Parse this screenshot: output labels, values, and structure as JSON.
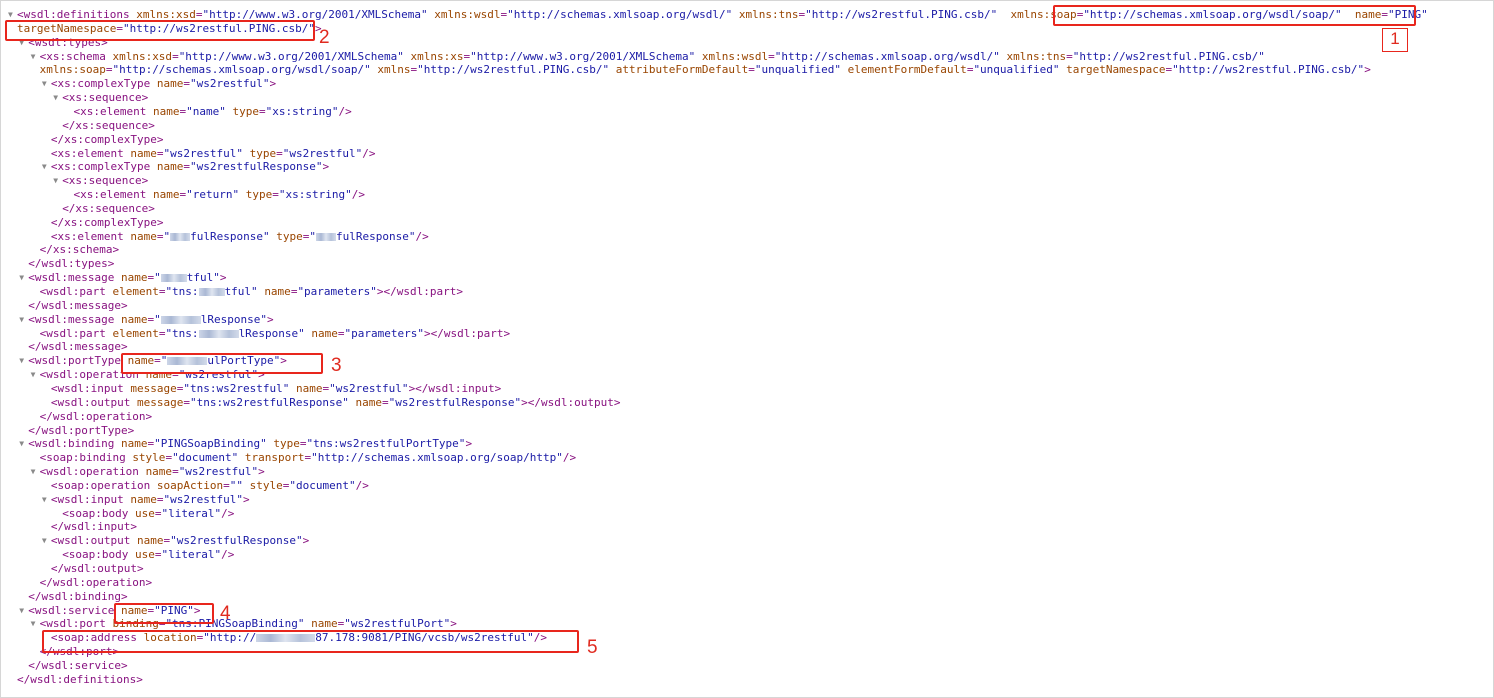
{
  "lines": [
    {
      "i": 0,
      "t": 1,
      "p": [
        [
          "t",
          "<wsdl:definitions "
        ],
        [
          "n",
          "xmlns:xsd"
        ],
        [
          "t",
          "="
        ],
        [
          "v",
          "\"http://www.w3.org/2001/XMLSchema\""
        ],
        [
          "t",
          " "
        ],
        [
          "n",
          "xmlns:wsdl"
        ],
        [
          "t",
          "="
        ],
        [
          "v",
          "\"http://schemas.xmlsoap.org/wsdl/\""
        ],
        [
          "t",
          " "
        ],
        [
          "n",
          "xmlns:tns"
        ],
        [
          "t",
          "="
        ],
        [
          "v",
          "\"http://ws2restful.PING.csb/\""
        ],
        [
          "t",
          "  "
        ],
        [
          "n",
          "xmlns:soap"
        ],
        [
          "t",
          "="
        ],
        [
          "v",
          "\"http://schemas.xmlsoap.org/wsdl/soap/\""
        ],
        [
          "t",
          "  "
        ],
        [
          "n",
          "name"
        ],
        [
          "t",
          "="
        ],
        [
          "v",
          "\"PING\""
        ]
      ]
    },
    {
      "i": 0,
      "t": 0,
      "p": [
        [
          "n",
          "targetNamespace"
        ],
        [
          "t",
          "="
        ],
        [
          "v",
          "\"http://ws2restful.PING.csb/\""
        ],
        [
          "t",
          ">"
        ]
      ]
    },
    {
      "i": 1,
      "t": 1,
      "p": [
        [
          "t",
          "<wsdl:types>"
        ]
      ]
    },
    {
      "i": 2,
      "t": 1,
      "p": [
        [
          "t",
          "<xs:schema "
        ],
        [
          "n",
          "xmlns:xsd"
        ],
        [
          "t",
          "="
        ],
        [
          "v",
          "\"http://www.w3.org/2001/XMLSchema\""
        ],
        [
          "t",
          " "
        ],
        [
          "n",
          "xmlns:xs"
        ],
        [
          "t",
          "="
        ],
        [
          "v",
          "\"http://www.w3.org/2001/XMLSchema\""
        ],
        [
          "t",
          " "
        ],
        [
          "n",
          "xmlns:wsdl"
        ],
        [
          "t",
          "="
        ],
        [
          "v",
          "\"http://schemas.xmlsoap.org/wsdl/\""
        ],
        [
          "t",
          " "
        ],
        [
          "n",
          "xmlns:tns"
        ],
        [
          "t",
          "="
        ],
        [
          "v",
          "\"http://ws2restful.PING.csb/\""
        ]
      ]
    },
    {
      "i": 2,
      "t": 0,
      "p": [
        [
          "n",
          "xmlns:soap"
        ],
        [
          "t",
          "="
        ],
        [
          "v",
          "\"http://schemas.xmlsoap.org/wsdl/soap/\""
        ],
        [
          "t",
          " "
        ],
        [
          "n",
          "xmlns"
        ],
        [
          "t",
          "="
        ],
        [
          "v",
          "\"http://ws2restful.PING.csb/\""
        ],
        [
          "t",
          " "
        ],
        [
          "n",
          "attributeFormDefault"
        ],
        [
          "t",
          "="
        ],
        [
          "v",
          "\"unqualified\""
        ],
        [
          "t",
          " "
        ],
        [
          "n",
          "elementFormDefault"
        ],
        [
          "t",
          "="
        ],
        [
          "v",
          "\"unqualified\""
        ],
        [
          "t",
          " "
        ],
        [
          "n",
          "targetNamespace"
        ],
        [
          "t",
          "="
        ],
        [
          "v",
          "\"http://ws2restful.PING.csb/\""
        ],
        [
          "t",
          ">"
        ]
      ]
    },
    {
      "i": 3,
      "t": 1,
      "p": [
        [
          "t",
          "<xs:complexType "
        ],
        [
          "n",
          "name"
        ],
        [
          "t",
          "="
        ],
        [
          "v",
          "\"ws2restful\""
        ],
        [
          "t",
          ">"
        ]
      ]
    },
    {
      "i": 4,
      "t": 1,
      "p": [
        [
          "t",
          "<xs:sequence>"
        ]
      ]
    },
    {
      "i": 5,
      "t": 0,
      "p": [
        [
          "t",
          "<xs:element "
        ],
        [
          "n",
          "name"
        ],
        [
          "t",
          "="
        ],
        [
          "v",
          "\"name\""
        ],
        [
          "t",
          " "
        ],
        [
          "n",
          "type"
        ],
        [
          "t",
          "="
        ],
        [
          "v",
          "\"xs:string\""
        ],
        [
          "t",
          "/>"
        ]
      ]
    },
    {
      "i": 4,
      "t": 0,
      "p": [
        [
          "t",
          "</xs:sequence>"
        ]
      ]
    },
    {
      "i": 3,
      "t": 0,
      "p": [
        [
          "t",
          "</xs:complexType>"
        ]
      ]
    },
    {
      "i": 3,
      "t": 0,
      "p": [
        [
          "t",
          "<xs:element "
        ],
        [
          "n",
          "name"
        ],
        [
          "t",
          "="
        ],
        [
          "v",
          "\"ws2restful\""
        ],
        [
          "t",
          " "
        ],
        [
          "n",
          "type"
        ],
        [
          "t",
          "="
        ],
        [
          "v",
          "\"ws2restful\""
        ],
        [
          "t",
          "/>"
        ]
      ]
    },
    {
      "i": 3,
      "t": 1,
      "p": [
        [
          "t",
          "<xs:complexType "
        ],
        [
          "n",
          "name"
        ],
        [
          "t",
          "="
        ],
        [
          "v",
          "\"ws2restfulResponse\""
        ],
        [
          "t",
          ">"
        ]
      ]
    },
    {
      "i": 4,
      "t": 1,
      "p": [
        [
          "t",
          "<xs:sequence>"
        ]
      ]
    },
    {
      "i": 5,
      "t": 0,
      "p": [
        [
          "t",
          "<xs:element "
        ],
        [
          "n",
          "name"
        ],
        [
          "t",
          "="
        ],
        [
          "v",
          "\"return\""
        ],
        [
          "t",
          " "
        ],
        [
          "n",
          "type"
        ],
        [
          "t",
          "="
        ],
        [
          "v",
          "\"xs:string\""
        ],
        [
          "t",
          "/>"
        ]
      ]
    },
    {
      "i": 4,
      "t": 0,
      "p": [
        [
          "t",
          "</xs:sequence>"
        ]
      ]
    },
    {
      "i": 3,
      "t": 0,
      "p": [
        [
          "t",
          "</xs:complexType>"
        ]
      ]
    },
    {
      "i": 3,
      "t": 0,
      "p": [
        [
          "t",
          "<xs:element "
        ],
        [
          "n",
          "name"
        ],
        [
          "t",
          "="
        ],
        [
          "v",
          "\""
        ],
        [
          "b",
          3
        ],
        [
          "v",
          "fulResponse\""
        ],
        [
          "t",
          " "
        ],
        [
          "n",
          "type"
        ],
        [
          "t",
          "="
        ],
        [
          "v",
          "\""
        ],
        [
          "b",
          3
        ],
        [
          "v",
          "fulResponse\""
        ],
        [
          "t",
          "/>"
        ]
      ]
    },
    {
      "i": 2,
      "t": 0,
      "p": [
        [
          "t",
          "</xs:schema>"
        ]
      ]
    },
    {
      "i": 1,
      "t": 0,
      "p": [
        [
          "t",
          "</wsdl:types>"
        ]
      ]
    },
    {
      "i": 1,
      "t": 1,
      "p": [
        [
          "t",
          "<wsdl:message "
        ],
        [
          "n",
          "name"
        ],
        [
          "t",
          "="
        ],
        [
          "v",
          "\""
        ],
        [
          "b",
          4
        ],
        [
          "v",
          "tful\""
        ],
        [
          "t",
          ">"
        ]
      ]
    },
    {
      "i": 2,
      "t": 0,
      "p": [
        [
          "t",
          "<wsdl:part "
        ],
        [
          "n",
          "element"
        ],
        [
          "t",
          "="
        ],
        [
          "v",
          "\"tns:"
        ],
        [
          "b",
          4
        ],
        [
          "v",
          "tful\""
        ],
        [
          "t",
          " "
        ],
        [
          "n",
          "name"
        ],
        [
          "t",
          "="
        ],
        [
          "v",
          "\"parameters\""
        ],
        [
          "t",
          "></wsdl:part>"
        ]
      ]
    },
    {
      "i": 1,
      "t": 0,
      "p": [
        [
          "t",
          "</wsdl:message>"
        ]
      ]
    },
    {
      "i": 1,
      "t": 1,
      "p": [
        [
          "t",
          "<wsdl:message "
        ],
        [
          "n",
          "name"
        ],
        [
          "t",
          "="
        ],
        [
          "v",
          "\""
        ],
        [
          "b",
          6
        ],
        [
          "v",
          "lResponse\""
        ],
        [
          "t",
          ">"
        ]
      ]
    },
    {
      "i": 2,
      "t": 0,
      "p": [
        [
          "t",
          "<wsdl:part "
        ],
        [
          "n",
          "element"
        ],
        [
          "t",
          "="
        ],
        [
          "v",
          "\"tns:"
        ],
        [
          "b",
          6
        ],
        [
          "v",
          "lResponse\""
        ],
        [
          "t",
          " "
        ],
        [
          "n",
          "name"
        ],
        [
          "t",
          "="
        ],
        [
          "v",
          "\"parameters\""
        ],
        [
          "t",
          "></wsdl:part>"
        ]
      ]
    },
    {
      "i": 1,
      "t": 0,
      "p": [
        [
          "t",
          "</wsdl:message>"
        ]
      ]
    },
    {
      "i": 1,
      "t": 1,
      "p": [
        [
          "t",
          "<wsdl:portType "
        ],
        [
          "n",
          "name"
        ],
        [
          "t",
          "="
        ],
        [
          "v",
          "\""
        ],
        [
          "b",
          6
        ],
        [
          "v",
          "ulPortType\""
        ],
        [
          "t",
          ">"
        ]
      ]
    },
    {
      "i": 2,
      "t": 1,
      "p": [
        [
          "t",
          "<wsdl:operation "
        ],
        [
          "n",
          "name"
        ],
        [
          "t",
          "="
        ],
        [
          "v",
          "\"ws2restful\""
        ],
        [
          "t",
          ">"
        ]
      ]
    },
    {
      "i": 3,
      "t": 0,
      "p": [
        [
          "t",
          "<wsdl:input "
        ],
        [
          "n",
          "message"
        ],
        [
          "t",
          "="
        ],
        [
          "v",
          "\"tns:ws2restful\""
        ],
        [
          "t",
          " "
        ],
        [
          "n",
          "name"
        ],
        [
          "t",
          "="
        ],
        [
          "v",
          "\"ws2restful\""
        ],
        [
          "t",
          "></wsdl:input>"
        ]
      ]
    },
    {
      "i": 3,
      "t": 0,
      "p": [
        [
          "t",
          "<wsdl:output "
        ],
        [
          "n",
          "message"
        ],
        [
          "t",
          "="
        ],
        [
          "v",
          "\"tns:ws2restfulResponse\""
        ],
        [
          "t",
          " "
        ],
        [
          "n",
          "name"
        ],
        [
          "t",
          "="
        ],
        [
          "v",
          "\"ws2restfulResponse\""
        ],
        [
          "t",
          "></wsdl:output>"
        ]
      ]
    },
    {
      "i": 2,
      "t": 0,
      "p": [
        [
          "t",
          "</wsdl:operation>"
        ]
      ]
    },
    {
      "i": 1,
      "t": 0,
      "p": [
        [
          "t",
          "</wsdl:portType>"
        ]
      ]
    },
    {
      "i": 1,
      "t": 1,
      "p": [
        [
          "t",
          "<wsdl:binding "
        ],
        [
          "n",
          "name"
        ],
        [
          "t",
          "="
        ],
        [
          "v",
          "\"PINGSoapBinding\""
        ],
        [
          "t",
          " "
        ],
        [
          "n",
          "type"
        ],
        [
          "t",
          "="
        ],
        [
          "v",
          "\"tns:ws2restfulPortType\""
        ],
        [
          "t",
          ">"
        ]
      ]
    },
    {
      "i": 2,
      "t": 0,
      "p": [
        [
          "t",
          "<soap:binding "
        ],
        [
          "n",
          "style"
        ],
        [
          "t",
          "="
        ],
        [
          "v",
          "\"document\""
        ],
        [
          "t",
          " "
        ],
        [
          "n",
          "transport"
        ],
        [
          "t",
          "="
        ],
        [
          "v",
          "\"http://schemas.xmlsoap.org/soap/http\""
        ],
        [
          "t",
          "/>"
        ]
      ]
    },
    {
      "i": 2,
      "t": 1,
      "p": [
        [
          "t",
          "<wsdl:operation "
        ],
        [
          "n",
          "name"
        ],
        [
          "t",
          "="
        ],
        [
          "v",
          "\"ws2restful\""
        ],
        [
          "t",
          ">"
        ]
      ]
    },
    {
      "i": 3,
      "t": 0,
      "p": [
        [
          "t",
          "<soap:operation "
        ],
        [
          "n",
          "soapAction"
        ],
        [
          "t",
          "="
        ],
        [
          "v",
          "\"\""
        ],
        [
          "t",
          " "
        ],
        [
          "n",
          "style"
        ],
        [
          "t",
          "="
        ],
        [
          "v",
          "\"document\""
        ],
        [
          "t",
          "/>"
        ]
      ]
    },
    {
      "i": 3,
      "t": 1,
      "p": [
        [
          "t",
          "<wsdl:input "
        ],
        [
          "n",
          "name"
        ],
        [
          "t",
          "="
        ],
        [
          "v",
          "\"ws2restful\""
        ],
        [
          "t",
          ">"
        ]
      ]
    },
    {
      "i": 4,
      "t": 0,
      "p": [
        [
          "t",
          "<soap:body "
        ],
        [
          "n",
          "use"
        ],
        [
          "t",
          "="
        ],
        [
          "v",
          "\"literal\""
        ],
        [
          "t",
          "/>"
        ]
      ]
    },
    {
      "i": 3,
      "t": 0,
      "p": [
        [
          "t",
          "</wsdl:input>"
        ]
      ]
    },
    {
      "i": 3,
      "t": 1,
      "p": [
        [
          "t",
          "<wsdl:output "
        ],
        [
          "n",
          "name"
        ],
        [
          "t",
          "="
        ],
        [
          "v",
          "\"ws2restfulResponse\""
        ],
        [
          "t",
          ">"
        ]
      ]
    },
    {
      "i": 4,
      "t": 0,
      "p": [
        [
          "t",
          "<soap:body "
        ],
        [
          "n",
          "use"
        ],
        [
          "t",
          "="
        ],
        [
          "v",
          "\"literal\""
        ],
        [
          "t",
          "/>"
        ]
      ]
    },
    {
      "i": 3,
      "t": 0,
      "p": [
        [
          "t",
          "</wsdl:output>"
        ]
      ]
    },
    {
      "i": 2,
      "t": 0,
      "p": [
        [
          "t",
          "</wsdl:operation>"
        ]
      ]
    },
    {
      "i": 1,
      "t": 0,
      "p": [
        [
          "t",
          "</wsdl:binding>"
        ]
      ]
    },
    {
      "i": 1,
      "t": 1,
      "p": [
        [
          "t",
          "<wsdl:service "
        ],
        [
          "n",
          "name"
        ],
        [
          "t",
          "="
        ],
        [
          "v",
          "\"PING\""
        ],
        [
          "t",
          ">"
        ]
      ]
    },
    {
      "i": 2,
      "t": 1,
      "p": [
        [
          "t",
          "<wsdl:port "
        ],
        [
          "n",
          "binding"
        ],
        [
          "t",
          "="
        ],
        [
          "v",
          "\"tns:PINGSoapBinding\""
        ],
        [
          "t",
          " "
        ],
        [
          "n",
          "name"
        ],
        [
          "t",
          "="
        ],
        [
          "v",
          "\"ws2restfulPort\""
        ],
        [
          "t",
          ">"
        ]
      ]
    },
    {
      "i": 3,
      "t": 0,
      "p": [
        [
          "t",
          "<soap:address "
        ],
        [
          "n",
          "location"
        ],
        [
          "t",
          "="
        ],
        [
          "v",
          "\"http://"
        ],
        [
          "b",
          9
        ],
        [
          "v",
          "87.178:9081/PING/vcsb/ws2restful\""
        ],
        [
          "t",
          "/>"
        ]
      ]
    },
    {
      "i": 2,
      "t": 0,
      "p": [
        [
          "t",
          "</wsdl:port>"
        ]
      ]
    },
    {
      "i": 1,
      "t": 0,
      "p": [
        [
          "t",
          "</wsdl:service>"
        ]
      ]
    },
    {
      "i": 0,
      "t": 0,
      "p": [
        [
          "t",
          "</wsdl:definitions>"
        ]
      ]
    }
  ],
  "annotations": {
    "n1": "1",
    "n2": "2",
    "n3": "3",
    "n4": "4",
    "n5": "5"
  },
  "colors": {
    "tag": "#881280",
    "attr_name": "#994500",
    "attr_value": "#1a1aa6",
    "highlight": "#e8261d"
  }
}
